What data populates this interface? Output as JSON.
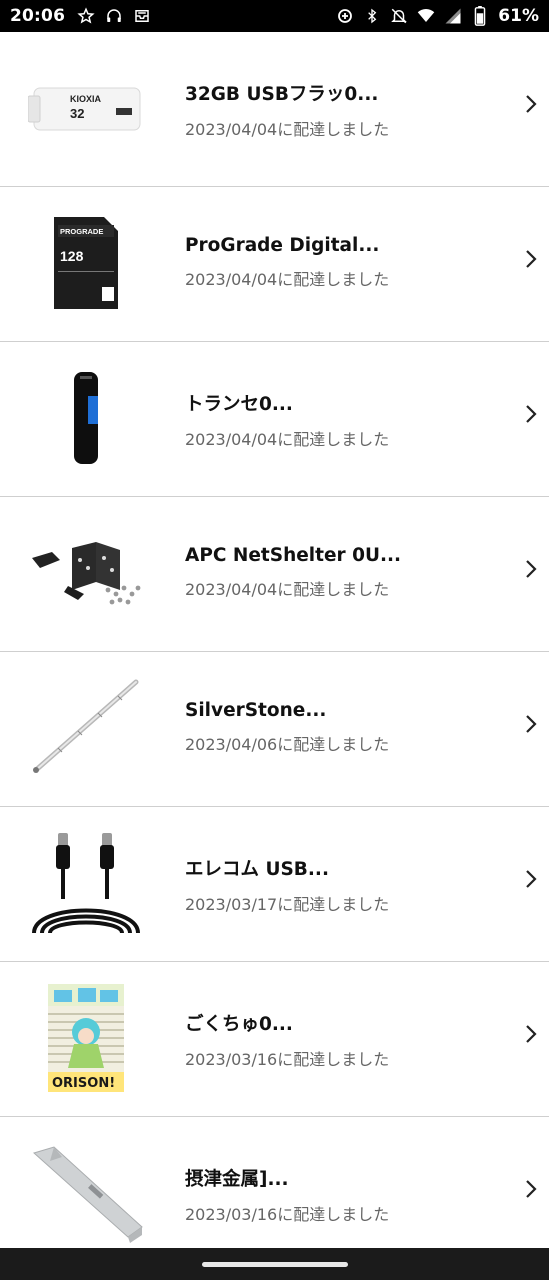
{
  "status": {
    "time": "20:06",
    "battery": "61%",
    "icons_left": [
      "star-icon",
      "headphones-icon",
      "inbox-icon"
    ],
    "icons_right": [
      "data-saver-icon",
      "bluetooth-icon",
      "bell-off-icon",
      "wifi-icon",
      "signal-icon",
      "battery-icon"
    ]
  },
  "orders": [
    {
      "title": "32GB USBフラッ0...",
      "date": "2023/04/04に配達しました",
      "thumb": "usb-flash-drive-image",
      "thumb_text": "KIOXIA",
      "thumb_sub": "32"
    },
    {
      "title": "ProGrade Digital...",
      "date": "2023/04/04に配達しました",
      "thumb": "sd-card-image",
      "thumb_text": "PROGRADE",
      "thumb_sub": "128"
    },
    {
      "title": "トランセ0...",
      "date": "2023/04/04に配達しました",
      "thumb": "usb-stick-image",
      "thumb_text": "",
      "thumb_sub": ""
    },
    {
      "title": "APC NetShelter 0U...",
      "date": "2023/04/04に配達しました",
      "thumb": "rack-bracket-image",
      "thumb_text": "",
      "thumb_sub": ""
    },
    {
      "title": "SilverStone...",
      "date": "2023/04/06に配達しました",
      "thumb": "antenna-rod-image",
      "thumb_text": "",
      "thumb_sub": ""
    },
    {
      "title": "エレコム USB...",
      "date": "2023/03/17に配達しました",
      "thumb": "usb-cable-image",
      "thumb_text": "",
      "thumb_sub": ""
    },
    {
      "title": "ごくちゅ0...",
      "date": "2023/03/16に配達しました",
      "thumb": "manga-cover-image",
      "thumb_text": "ORISON!",
      "thumb_sub": ""
    },
    {
      "title": "摂津金属]...",
      "date": "2023/03/16に配達しました",
      "thumb": "metal-bracket-image",
      "thumb_text": "",
      "thumb_sub": ""
    }
  ],
  "colors": {
    "text": "#111111",
    "subtext": "#666666",
    "divider": "#cfcfcf",
    "statusbar": "#000000"
  }
}
